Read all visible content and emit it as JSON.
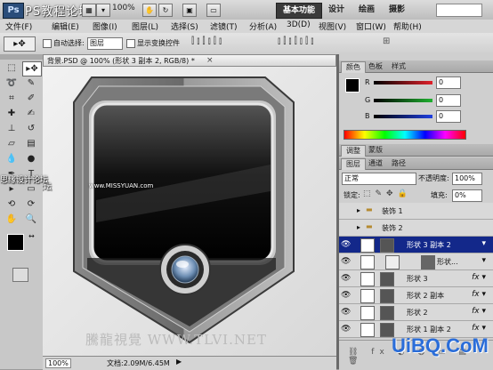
{
  "app": {
    "logo": "Ps",
    "watermark_top": "PS教程论坛",
    "zoom": "100%",
    "workspaces": [
      "基本功能",
      "设计",
      "绘画",
      "摄影"
    ]
  },
  "menus": [
    "文件(F)",
    "编辑(E)",
    "图像(I)",
    "图层(L)",
    "选择(S)",
    "滤镜(T)",
    "分析(A)",
    "3D(D)",
    "视图(V)",
    "窗口(W)",
    "帮助(H)"
  ],
  "options": {
    "auto_select_label": "自动选择:",
    "auto_select_value": "图层",
    "show_transform_label": "显示变换控件"
  },
  "document": {
    "tab_title": "背景.PSD @ 100% (形状 3 副本 2, RGB/8) *",
    "watermark_left": "思缘设计论坛",
    "watermark_mid": "www.MISSYUAN.com",
    "watermark_bottom": "騰龍視覺 WWW.TLVI.NET",
    "zoom": "100%",
    "doc_size": "文档:2.09M/6.45M"
  },
  "color_panel": {
    "tabs": [
      "颜色",
      "色板",
      "样式"
    ],
    "channels": [
      {
        "label": "R",
        "value": "0",
        "color": "#e0202a"
      },
      {
        "label": "G",
        "value": "0",
        "color": "#20b030"
      },
      {
        "label": "B",
        "value": "0",
        "color": "#2040e0"
      }
    ]
  },
  "adjust_tabs": [
    "调整",
    "蒙版"
  ],
  "layers_panel": {
    "tabs": [
      "图层",
      "通道",
      "路径"
    ],
    "blend_mode": "正常",
    "opacity_label": "不透明度:",
    "opacity": "100%",
    "lock_label": "锁定:",
    "fill_label": "填充:",
    "fill": "0%",
    "layers": [
      {
        "name": "装饰 1",
        "type": "group",
        "visible": false,
        "selected": false
      },
      {
        "name": "装饰 2",
        "type": "group",
        "visible": false,
        "selected": false
      },
      {
        "name": "形状 3 副本 2",
        "type": "shape",
        "visible": true,
        "selected": true
      },
      {
        "name": "形状...",
        "type": "shape-mask",
        "visible": true,
        "selected": false
      },
      {
        "name": "形状 3",
        "type": "shape",
        "visible": true,
        "selected": false
      },
      {
        "name": "形状 2 副本",
        "type": "shape",
        "visible": true,
        "selected": false
      },
      {
        "name": "形状 2",
        "type": "shape",
        "visible": true,
        "selected": false
      },
      {
        "name": "形状 1 副本 2",
        "type": "shape",
        "visible": true,
        "selected": false
      }
    ],
    "watermark": "UiBQ.CoM"
  },
  "tools": [
    "move",
    "marquee",
    "lasso",
    "quick-select",
    "crop",
    "eyedropper",
    "heal",
    "brush",
    "stamp",
    "history",
    "eraser",
    "gradient",
    "blur",
    "dodge",
    "pen",
    "type",
    "path-select",
    "shape",
    "3d-rotate",
    "3d-orbit",
    "hand",
    "zoom"
  ]
}
